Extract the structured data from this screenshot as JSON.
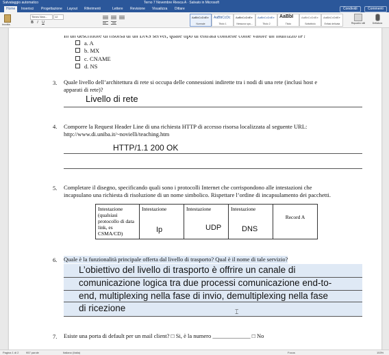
{
  "titlebar": {
    "autosave": "Salvataggio automatico",
    "title": "Terno 7 Novembre Riesca A · Salvato in Microsoft"
  },
  "tabs": [
    "Home",
    "Inserisci",
    "Progettazione",
    "Layout",
    "Riferimenti",
    "Lettere",
    "Revisione",
    "Visualizza",
    "Dittare"
  ],
  "share_label": "Condividi",
  "comments_label": "Commenti",
  "ribbon": {
    "paste_label": "Incolla",
    "font_name": "Times New...",
    "font_size": "12",
    "bold": "B",
    "italic": "I",
    "underline": "U",
    "styles": [
      {
        "sample": "AaBbCcDdEe",
        "name": "Normale"
      },
      {
        "sample": "AaBbCcDc",
        "name": "Titolo 1"
      },
      {
        "sample": "AaBbCcDdEe",
        "name": "Nessuna spa..."
      },
      {
        "sample": "AaBbCcDdEe",
        "name": "Titolo 2"
      },
      {
        "sample": "AaBbI",
        "name": "Titolo"
      },
      {
        "sample": "AaBbCcDdEe",
        "name": "Sottotitolo"
      },
      {
        "sample": "AaBbCcDdEe",
        "name": "Enfasi delicata"
      }
    ],
    "styles_pane": "Riquadro stili",
    "dictate": "Dettatura"
  },
  "document": {
    "q2_partial": "In un descrittore di risorsa di un DNS server, quale tipo di entrata contiene come valore un indirizzo IP?",
    "q2_options": [
      "a. A",
      "b. MX",
      "c. CNAME",
      "d. NS"
    ],
    "q3_num": "3.",
    "q3_line1": "Quale livello dell’architettura di rete si occupa delle connessioni indirette tra i nodi di una rete (inclusi host e",
    "q3_line2": "apparati di rete)?",
    "q3_answer": "Livello di rete",
    "q4_num": "4.",
    "q4_line1": "Comporre la Request Header Line di una richiesta HTTP di accesso risorsa localizzata al seguente URL:",
    "q4_line2": "http://www.di.uniba.it/~novielli/teaching.htm",
    "q4_answer": "HTTP/1.1 200 OK",
    "q5_num": "5.",
    "q5_line1": "Completare il disegno, specificando quali sono i protocolli Internet che corrispondono alle intestazioni che",
    "q5_line2": "incapsulano una richiesta di risoluzione di un nome simbolico. Rispettare l’ordine di incapsulamento dei pacchetti.",
    "table_headers": [
      "Intestazione (qualsiasi protocollo di data link, es CSMA/CD)",
      "Intestazione",
      "Intestazione",
      "Intestazione",
      "Record A"
    ],
    "table_answers": [
      "",
      "Ip",
      "UDP",
      "DNS",
      ""
    ],
    "q6_num": "6.",
    "q6_question": "Quale è la funzionalità principale offerta dal livello di trasporto? Qual è il nome di tale servizio?",
    "q6_answer_lines": [
      "L’obiettivo del livello di trasporto è offrire un canale di",
      "comunicazione logica tra due processi comunicazione end-to-",
      "end, multiplexing nella fase di invio, demultiplexing nella fase",
      "di ricezione"
    ],
    "q7_num": "7.",
    "q7_line": "Esiste una porta di default per un mail client? □ Si, è la numero _____________ □ No"
  },
  "statusbar": {
    "page": "Pagina 1 di 2",
    "words": "957 parole",
    "language": "Italiano (Italia)",
    "focus": "Focus",
    "zoom": "153%"
  }
}
